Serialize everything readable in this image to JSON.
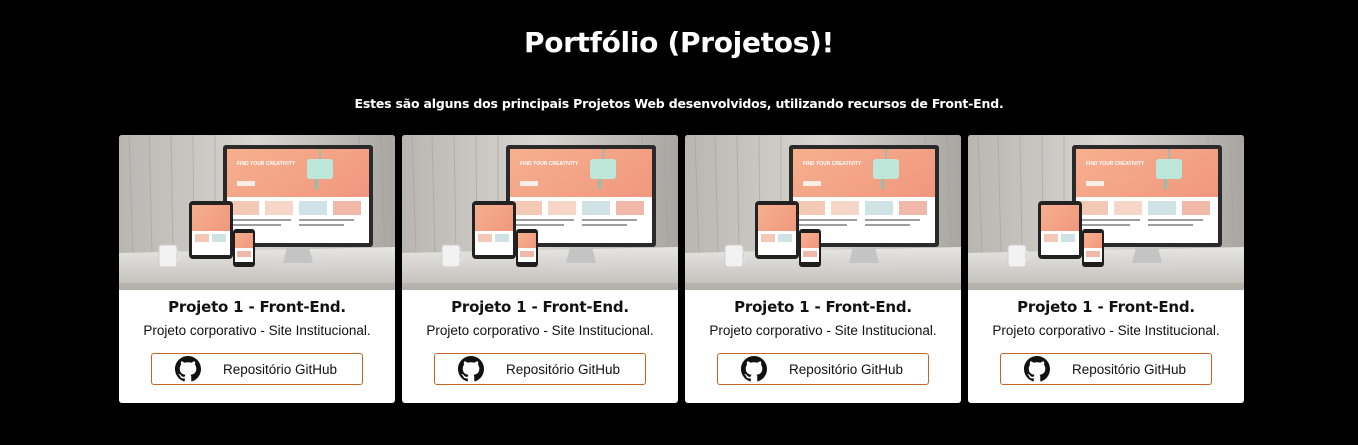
{
  "section": {
    "title": "Portfólio (Projetos)!",
    "subtitle": "Estes são alguns dos principais Projetos Web desenvolvidos, utilizando recursos de Front-End."
  },
  "colors": {
    "background": "#000000",
    "card_background": "#ffffff",
    "button_border": "#c8642a"
  },
  "projects": [
    {
      "image_icon": "responsive-devices-mockup",
      "mockup_text": "FIND YOUR CREATIVITY",
      "title": "Projeto 1 - Front-End.",
      "description": "Projeto corporativo - Site Institucional.",
      "button_icon": "github-icon",
      "button_label": "Repositório GitHub"
    },
    {
      "image_icon": "responsive-devices-mockup",
      "mockup_text": "FIND YOUR CREATIVITY",
      "title": "Projeto 1 - Front-End.",
      "description": "Projeto corporativo - Site Institucional.",
      "button_icon": "github-icon",
      "button_label": "Repositório GitHub"
    },
    {
      "image_icon": "responsive-devices-mockup",
      "mockup_text": "FIND YOUR CREATIVITY",
      "title": "Projeto 1 - Front-End.",
      "description": "Projeto corporativo - Site Institucional.",
      "button_icon": "github-icon",
      "button_label": "Repositório GitHub"
    },
    {
      "image_icon": "responsive-devices-mockup",
      "mockup_text": "FIND YOUR CREATIVITY",
      "title": "Projeto 1 - Front-End.",
      "description": "Projeto corporativo - Site Institucional.",
      "button_icon": "github-icon",
      "button_label": "Repositório GitHub"
    }
  ]
}
